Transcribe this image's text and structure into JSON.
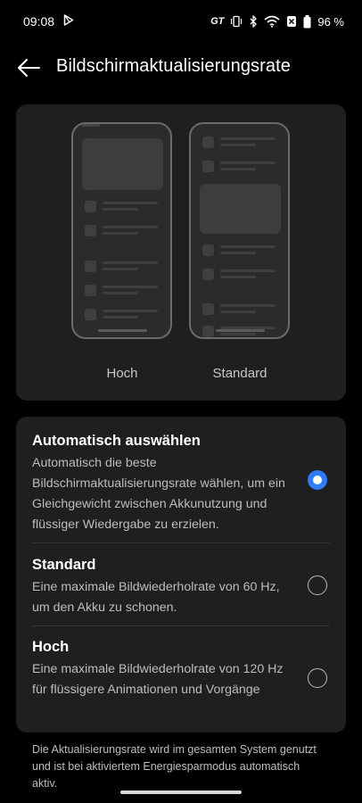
{
  "status_bar": {
    "time": "09:08",
    "battery": "96 %",
    "gt_label": "GT",
    "icons": [
      "play-store-icon",
      "vibrate-icon",
      "bluetooth-icon",
      "wifi-icon",
      "no-sim-icon",
      "battery-icon"
    ]
  },
  "header": {
    "title": "Bildschirmaktualisierungsrate"
  },
  "preview": {
    "left_label": "Hoch",
    "right_label": "Standard"
  },
  "options": [
    {
      "title": "Automatisch auswählen",
      "description": "Automatisch die beste Bildschirmaktualisierungsrate wählen, um ein Gleichgewicht zwischen Akkunutzung und flüssiger Wiedergabe zu erzielen.",
      "selected": true
    },
    {
      "title": "Standard",
      "description": "Eine maximale Bildwiederholrate von 60 Hz, um den Akku zu schonen.",
      "selected": false
    },
    {
      "title": "Hoch",
      "description": "Eine maximale Bildwiederholrate von 120 Hz für flüssigere Animationen und Vorgänge",
      "selected": false
    }
  ],
  "footer_note": "Die Aktualisierungsrate wird im gesamten System genutzt und ist bei aktiviertem Energiesparmodus automatisch aktiv.",
  "colors": {
    "accent": "#2f7df6",
    "background": "#000000",
    "card": "#1f1f1f"
  }
}
